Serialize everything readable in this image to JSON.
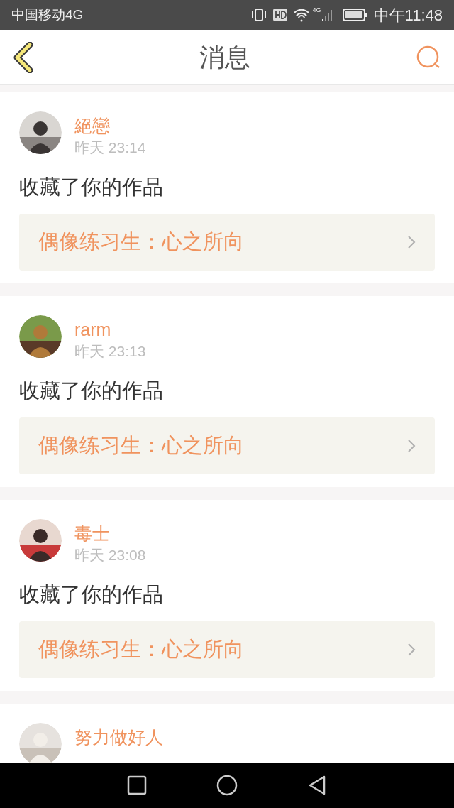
{
  "status_bar": {
    "carrier": "中国移动4G",
    "network": "4G",
    "time": "中午11:48"
  },
  "header": {
    "title": "消息"
  },
  "messages": [
    {
      "user": "絕戀",
      "time": "昨天 23:14",
      "action": "收藏了你的作品",
      "work": "偶像练习生：心之所向"
    },
    {
      "user": "rarm",
      "time": "昨天 23:13",
      "action": "收藏了你的作品",
      "work": "偶像练习生：心之所向"
    },
    {
      "user": "毒士",
      "time": "昨天 23:08",
      "action": "收藏了你的作品",
      "work": "偶像练习生：心之所向"
    },
    {
      "user": "努力做好人"
    }
  ]
}
